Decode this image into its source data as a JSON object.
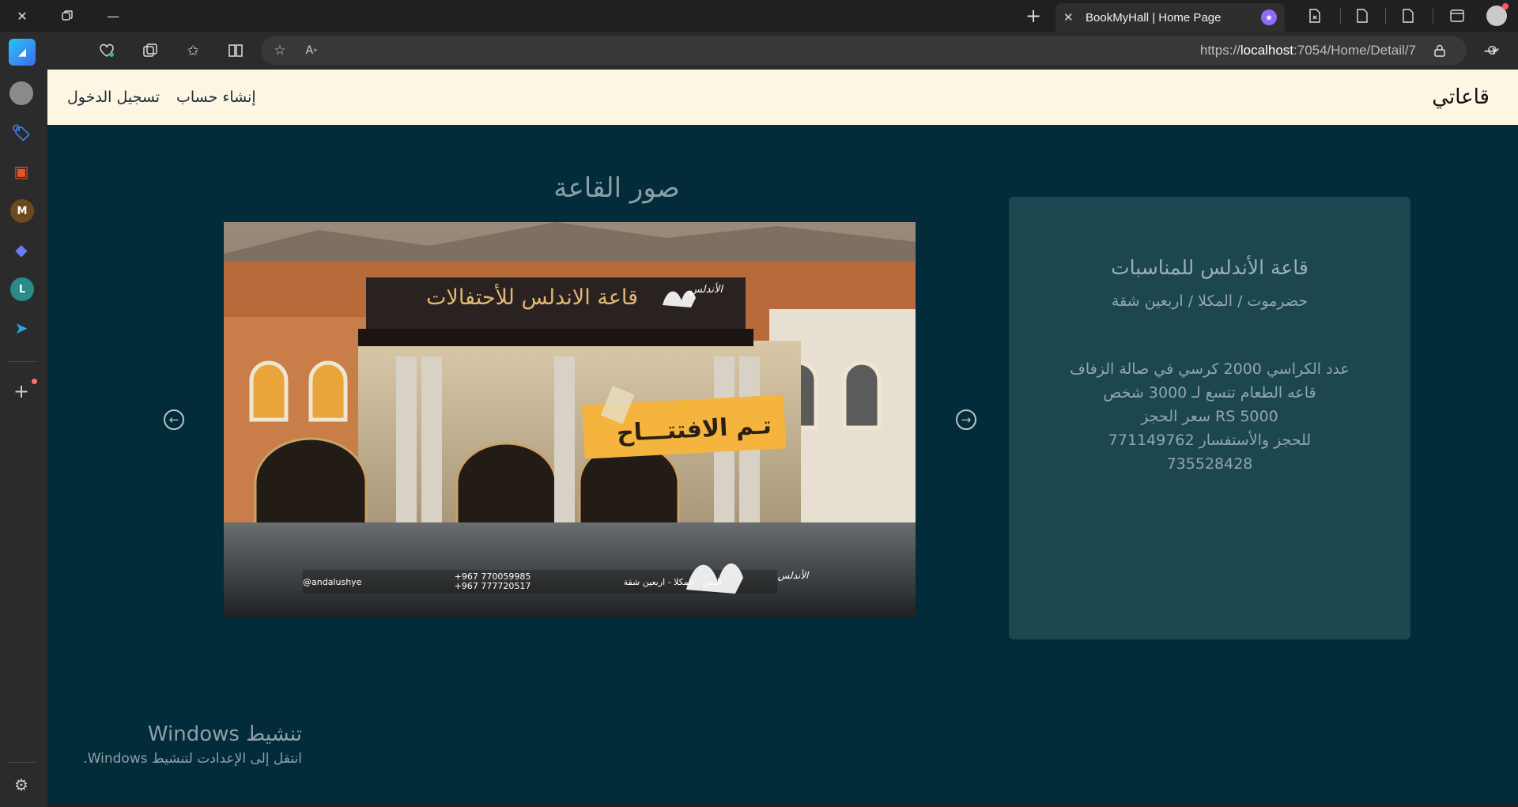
{
  "browser": {
    "tab_title": "BookMyHall | Home Page",
    "url_prefix": "https://",
    "url_host": "localhost",
    "url_path": ":7054/Home/Detail/7"
  },
  "sidebar": {
    "items": [
      {
        "name": "avatar-icon",
        "color": "#8a8a8a",
        "glyph": ""
      },
      {
        "name": "tag-icon",
        "color": "#3b82f6",
        "glyph": "🏷"
      },
      {
        "name": "toolbox-icon",
        "color": "#e2552b",
        "glyph": "🧰"
      },
      {
        "name": "m-app-icon",
        "color": "#6b4b1e",
        "glyph": "M"
      },
      {
        "name": "copilot-icon",
        "color": "#5a6bff",
        "glyph": "◆"
      },
      {
        "name": "l-app-icon",
        "color": "#2b8a8a",
        "glyph": "L"
      },
      {
        "name": "telegram-icon",
        "color": "#2aa3e0",
        "glyph": "➤"
      }
    ]
  },
  "site": {
    "brand": "قاعاتي",
    "nav": {
      "register": "إنشاء حساب",
      "login": "تسجيل الدخول"
    }
  },
  "gallery": {
    "title": "صور القاعة",
    "photo": {
      "sign": "قاعة الاندلس للأحتفالات",
      "logo": "الأندلس",
      "banner": "تـم الافتتـــاح",
      "footer_handle": "@andalushye",
      "footer_phone1": "+967 770059985",
      "footer_phone2": "+967 777720517",
      "footer_location": "اليمن - المكلا - اربعين شقة"
    }
  },
  "hall": {
    "name": "قاعة الأندلس للمناسبات",
    "location": "حضرموت / المكلا / اربعين شقة",
    "details": [
      "عدد الكراسي 2000 كرسي في صالة الزفاف",
      "قاعه الطعام تتسع لـ 3000 شخص",
      "سعر الحجز RS 5000",
      "للحجز والأستفسار 771149762",
      "735528428"
    ]
  },
  "watermark": {
    "title": "تنشيط Windows",
    "subtitle": "انتقل إلى الإعدادت لتنشيط Windows."
  }
}
